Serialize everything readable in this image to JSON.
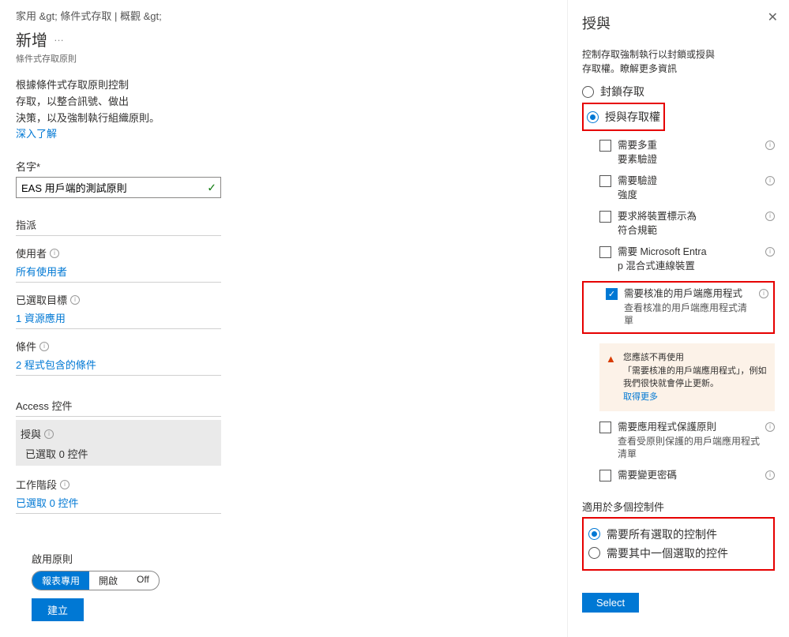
{
  "breadcrumb": {
    "home": "家用 &gt;",
    "ca": "條件式存取 | 概觀 &gt;"
  },
  "left": {
    "title": "新增",
    "more_glyph": "…",
    "subtitle": "條件式存取原則",
    "desc_l1": "根據條件式存取原則控制",
    "desc_l2": "存取，以整合訊號、做出",
    "desc_l3": "決策，以及強制執行組織原則。",
    "learn_more": "深入了解",
    "name_label": "名字",
    "name_value": "EAS 用戶端的測試原則",
    "assign_header": "指派",
    "users_label": "使用者",
    "users_value": "所有使用者",
    "targets_label": "已選取目標",
    "targets_value_prefix": "1",
    "targets_value_text": "資源應用",
    "conditions_label": "條件",
    "conditions_value_prefix": "2",
    "conditions_value_text": "程式包含的條件",
    "access_header": "Access 控件",
    "grant_label": "授與",
    "grant_value": "已選取 0 控件",
    "session_label": "工作階段",
    "session_value": "已選取 0 控件",
    "enable_label": "啟用原則",
    "seg_report": "報表專用",
    "seg_on": "開啟",
    "seg_off": "Off",
    "create": "建立"
  },
  "right": {
    "title": "授與",
    "close": "✕",
    "desc_l1": "控制存取強制執行以封鎖或授與",
    "desc_l2": "存取權。瞭解更多資訊",
    "opt_block": "封鎖存取",
    "opt_grant": "授與存取權",
    "chk_mfa_l1": "需要多重",
    "chk_mfa_l2": "要素驗證",
    "chk_strength_l1": "需要驗證",
    "chk_strength_l2": "強度",
    "chk_compliant_l1": "要求將裝置標示為",
    "chk_compliant_l2": "符合規範",
    "chk_entra_l1": "需要 Microsoft Entra",
    "chk_entra_l2": "p 混合式連線裝置",
    "chk_approved_l1": "需要核准的用戶端應用程式",
    "chk_approved_l2": "查看核准的用戶端應用程式清單",
    "warn_l1": "您應該不再使用",
    "warn_l2": "「需要核准的用戶端應用程式」，例如",
    "warn_l3": "我們很快就會停止更新。",
    "warn_more": "取得更多",
    "chk_protect_l1": "需要應用程式保護原則",
    "chk_protect_l2": "查看受原則保護的用戶端應用程式",
    "chk_protect_l3": "清單",
    "chk_pwchange": "需要變更密碼",
    "multi_label": "適用於多個控制件",
    "multi_all": "需要所有選取的控制件",
    "multi_one": "需要其中一個選取的控件",
    "select": "Select"
  }
}
